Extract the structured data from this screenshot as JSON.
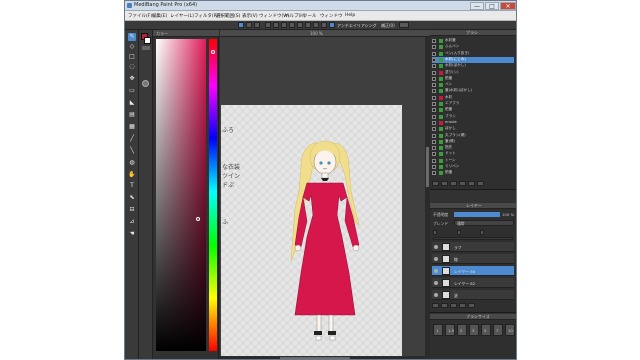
{
  "window": {
    "title": "MediBang Paint Pro (x64)",
    "min": "—",
    "max": "□",
    "close": "✕"
  },
  "menu": [
    "ファイル(F)",
    "編集(E)",
    "レイヤー(L)",
    "フィルタ(R)",
    "選択範囲(S)",
    "表示(V)",
    "ウィンドウ(W)",
    "ヘルプ(H)",
    "ツール",
    "ウィンドウ",
    "Help"
  ],
  "command_bar": {
    "antialias": "アンチエイリアシング",
    "correction": "補正(0)"
  },
  "tools": [
    "pen-tool",
    "eraser-tool",
    "selection-tool",
    "lasso-tool",
    "move-tool",
    "fill-tool",
    "gradient-tool",
    "select-pen-tool",
    "blur-tool",
    "smudge-tool",
    "brush-tool",
    "text-tool",
    "operation-tool",
    "eyedropper-tool",
    "hand-tool"
  ],
  "swatch": {
    "fg": "#c8193f",
    "bg": "#ffffff"
  },
  "color_panel": {
    "title": "カラー",
    "hue_color": "#e01e5a"
  },
  "canvas": {
    "title": "100 %",
    "notes": [
      "ふろ",
      "な衣装",
      "ツイン",
      "ドぷ",
      "ふ"
    ]
  },
  "brush_panel": {
    "title": "ブラシ",
    "items": [
      {
        "label": "水彩筆",
        "color": "#3a9f3a"
      },
      {
        "label": "ふんペン",
        "color": "#3a9f3a"
      },
      {
        "label": "ペン(入り抜き)",
        "color": "#3a9f3a"
      },
      {
        "label": "水彩(にじみ)",
        "color": "#3a9f3a",
        "selected": true
      },
      {
        "label": "水彩(ぼかし)",
        "color": "#3a9f3a"
      },
      {
        "label": "塗り(シ)",
        "color": "#c8193f"
      },
      {
        "label": "鉛筆",
        "color": "#3a9f3a"
      },
      {
        "label": "ペン",
        "color": "#3a9f3a"
      },
      {
        "label": "筆(水彩)(ぼかし)",
        "color": "#3a9f3a"
      },
      {
        "label": "水彩",
        "color": "#c8193f"
      },
      {
        "label": "エアブラ",
        "color": "#3a9f3a"
      },
      {
        "label": "鉛筆",
        "color": "#3a9f3a"
      },
      {
        "label": "ブラシ",
        "color": "#3a9f3a"
      },
      {
        "label": "ensole",
        "color": "#c8193f"
      },
      {
        "label": "ぼかし",
        "color": "#3a9f3a"
      },
      {
        "label": "丸ブラシ(硬)",
        "color": "#3a9f3a"
      },
      {
        "label": "筆(硬)",
        "color": "#3a9f3a"
      },
      {
        "label": "指先",
        "color": "#3a9f3a"
      },
      {
        "label": "ドット",
        "color": "#3a9f3a"
      },
      {
        "label": "トーン",
        "color": "#3a9f3a"
      },
      {
        "label": "ミリペン",
        "color": "#3a9f3a"
      },
      {
        "label": "鉛筆",
        "color": "#3a9f3a"
      }
    ]
  },
  "layer_panel": {
    "title": "レイヤー",
    "opacity_label": "不透明度",
    "opacity_value": "100 %",
    "blend_label": "ブレンド",
    "blend_value": "通常",
    "layers": [
      {
        "name": "ラフ"
      },
      {
        "name": "線"
      },
      {
        "name": "レイヤー 66",
        "selected": true
      },
      {
        "name": "レイヤー 82"
      },
      {
        "name": "塗"
      }
    ]
  },
  "navigator_panel": {
    "title": "ブラシサイズ",
    "sizes": [
      "1",
      "1.5",
      "2",
      "3",
      "5",
      "7",
      "10"
    ]
  }
}
